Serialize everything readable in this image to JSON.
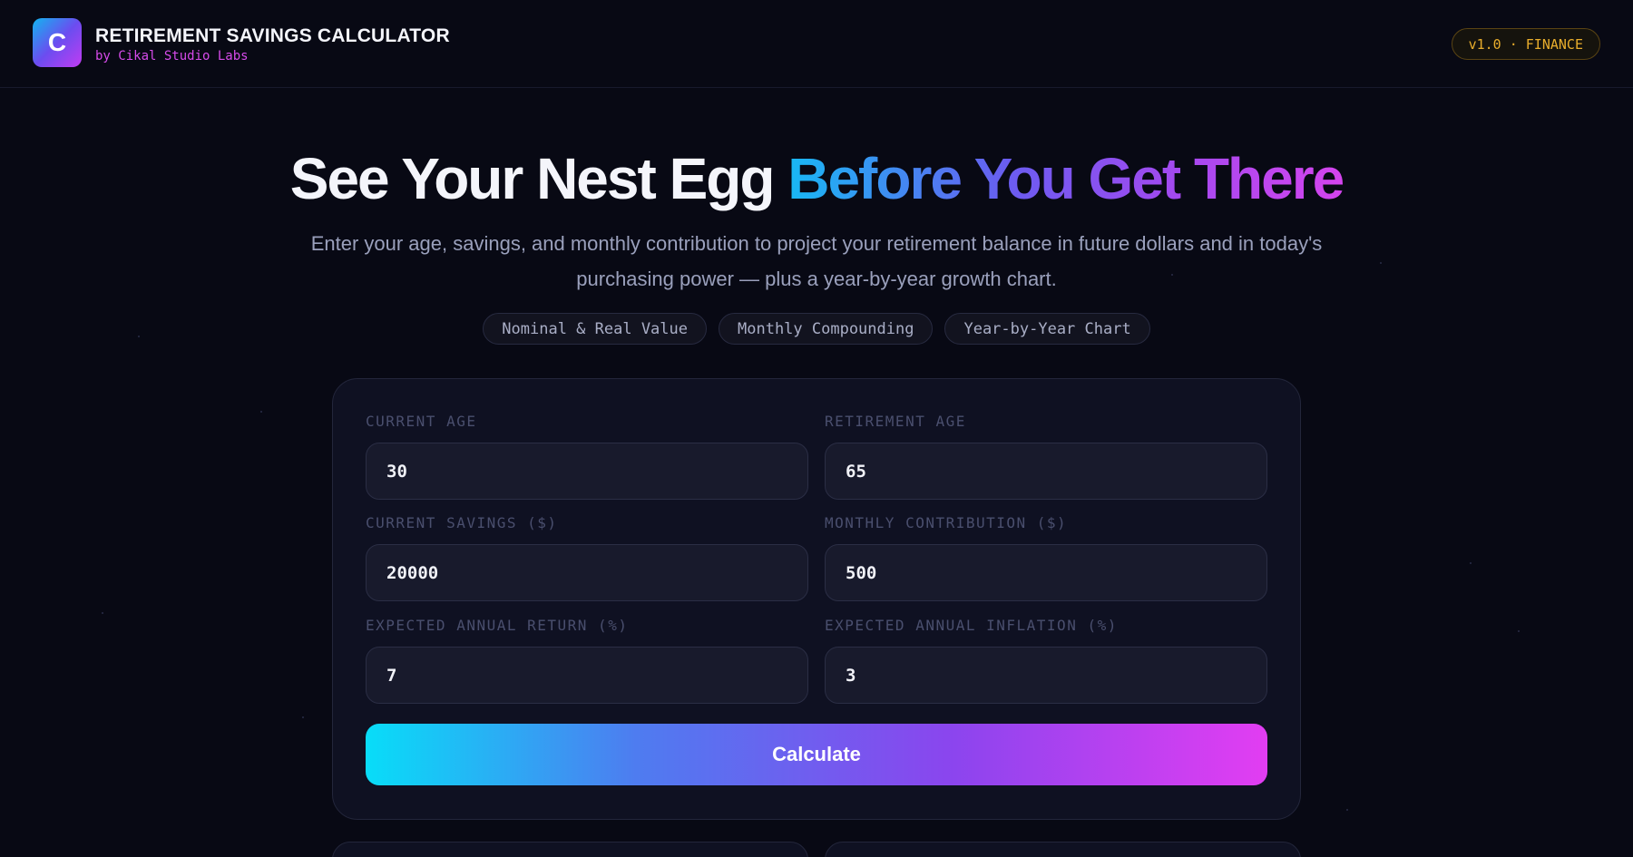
{
  "header": {
    "logo_letter": "C",
    "title": "RETIREMENT SAVINGS CALCULATOR",
    "subtitle": "by Cikal Studio Labs",
    "version": "v1.0 · FINANCE"
  },
  "hero": {
    "title_plain": "See Your Nest Egg ",
    "title_gradient": "Before You Get There",
    "description": "Enter your age, savings, and monthly contribution to project your retirement balance in future dollars and in today's purchasing power — plus a year-by-year growth chart.",
    "chips": [
      "Nominal & Real Value",
      "Monthly Compounding",
      "Year-by-Year Chart"
    ]
  },
  "form": {
    "current_age": {
      "label": "CURRENT AGE",
      "value": "30"
    },
    "retirement_age": {
      "label": "RETIREMENT AGE",
      "value": "65"
    },
    "current_savings": {
      "label": "CURRENT SAVINGS ($)",
      "value": "20000"
    },
    "monthly_contribution": {
      "label": "MONTHLY CONTRIBUTION ($)",
      "value": "500"
    },
    "annual_return": {
      "label": "EXPECTED ANNUAL RETURN (%)",
      "value": "7"
    },
    "annual_inflation": {
      "label": "EXPECTED ANNUAL INFLATION (%)",
      "value": "3"
    },
    "submit_label": "Calculate"
  },
  "colors": {
    "background": "#080914",
    "card": "#0f1122",
    "accent_cyan": "#08ddf8",
    "accent_magenta": "#e23df2",
    "version_gold": "#e8ad2c"
  }
}
